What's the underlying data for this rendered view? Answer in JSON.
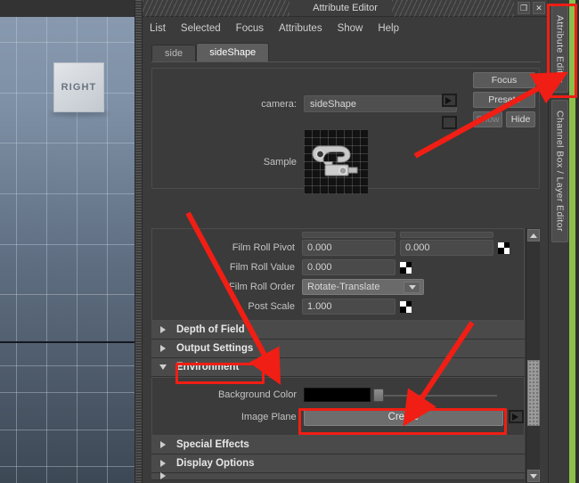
{
  "viewport": {
    "label": "RIGHT",
    "name": "right-orthographic-view"
  },
  "window": {
    "title": "Attribute Editor",
    "buttons": [
      {
        "name": "restore-window-button",
        "glyph": "❐"
      },
      {
        "name": "close-window-button",
        "glyph": "✕"
      }
    ]
  },
  "menu": {
    "items": [
      "List",
      "Selected",
      "Focus",
      "Attributes",
      "Show",
      "Help"
    ]
  },
  "tabs": [
    {
      "label": "side",
      "active": false
    },
    {
      "label": "sideShape",
      "active": true
    }
  ],
  "camera_section": {
    "camera_label": "camera:",
    "camera_value": "sideShape",
    "sample_label": "Sample",
    "buttons": {
      "focus": "Focus",
      "presets": "Presets",
      "show": "Show",
      "hide": "Hide"
    }
  },
  "attributes": {
    "rows": [
      {
        "label": "Film Roll Pivot",
        "values": [
          "0.000",
          "0.000"
        ],
        "type": "two-field"
      },
      {
        "label": "Film Roll Value",
        "values": [
          "0.000"
        ],
        "type": "one-field"
      },
      {
        "label": "Film Roll Order",
        "values": [
          "Rotate-Translate"
        ],
        "type": "dropdown"
      },
      {
        "label": "Post Scale",
        "values": [
          "1.000"
        ],
        "type": "one-field"
      }
    ]
  },
  "sections": [
    {
      "label": "Depth of Field",
      "expanded": false
    },
    {
      "label": "Output Settings",
      "expanded": false
    },
    {
      "label": "Environment",
      "expanded": true
    },
    {
      "label": "Special Effects",
      "expanded": false
    },
    {
      "label": "Display Options",
      "expanded": false
    }
  ],
  "environment": {
    "background_color_label": "Background Color",
    "background_color_value": "#000000",
    "image_plane_label": "Image Plane",
    "create_button": "Create"
  },
  "right_dock": {
    "tabs": [
      {
        "label": "Attribute Editor",
        "name": "vertical-tab-attribute-editor",
        "active": true
      },
      {
        "label": "Channel Box / Layer Editor",
        "name": "vertical-tab-channel-box",
        "active": false
      }
    ]
  },
  "annotations": {
    "highlight_color": "#f01e14",
    "boxes": [
      {
        "name": "highlight-attribute-editor-tab"
      },
      {
        "name": "highlight-environment-section"
      },
      {
        "name": "highlight-create-button"
      }
    ],
    "arrows": [
      {
        "name": "arrow-to-attribute-editor-tab"
      },
      {
        "name": "arrow-to-environment-section"
      },
      {
        "name": "arrow-to-create-button"
      }
    ]
  }
}
